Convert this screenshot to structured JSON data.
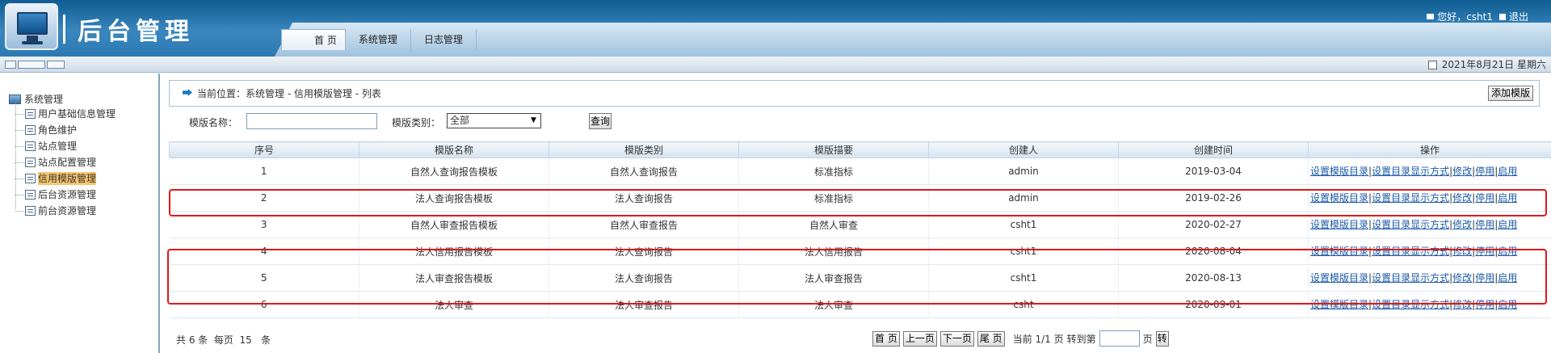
{
  "header": {
    "title": "后台管理",
    "greeting": "您好，csht1",
    "logout": "退出",
    "nav": [
      "首 页",
      "系统管理",
      "日志管理"
    ]
  },
  "subbar": {
    "date": "2021年8月21日 星期六"
  },
  "sidebar": {
    "root": "系统管理",
    "items": [
      "用户基础信息管理",
      "角色维护",
      "站点管理",
      "站点配置管理",
      "信用模版管理",
      "后台资源管理",
      "前台资源管理"
    ],
    "active_index": 4
  },
  "breadcrumb": {
    "label": "当前位置：",
    "path": "系统管理 - 信用模版管理 - 列表"
  },
  "toolbar": {
    "add_label": "添加模版"
  },
  "search": {
    "name_label": "模版名称：",
    "name_value": "",
    "type_label": "模版类别：",
    "type_value": "全部",
    "query_label": "查询"
  },
  "table": {
    "headers": [
      "序号",
      "模版名称",
      "模版类别",
      "模版描要",
      "创建人",
      "创建时间",
      "操作"
    ],
    "rows": [
      [
        "1",
        "自然人查询报告模板",
        "自然人查询报告",
        "标准指标",
        "admin",
        "2019-03-04"
      ],
      [
        "2",
        "法人查询报告模板",
        "法人查询报告",
        "标准指标",
        "admin",
        "2019-02-26"
      ],
      [
        "3",
        "自然人审查报告模板",
        "自然人审查报告",
        "自然人审查",
        "csht1",
        "2020-02-27"
      ],
      [
        "4",
        "法人信用报告模板",
        "法人查询报告",
        "法人信用报告",
        "csht1",
        "2020-08-04"
      ],
      [
        "5",
        "法人审查报告模板",
        "法人查询报告",
        "法人审查报告",
        "csht1",
        "2020-08-13"
      ],
      [
        "6",
        "法人审查",
        "法人审查报告",
        "法人审查",
        "csht",
        "2020-09-01"
      ]
    ],
    "ops": [
      "设置模版目录",
      "设置目录显示方式",
      "修改",
      "停用",
      "启用"
    ]
  },
  "pager": {
    "summary": "共 6 条  每页  15   条",
    "first": "首 页",
    "prev": "上一页",
    "next": "下一页",
    "last": "尾 页",
    "current": "当前 1/1 页",
    "jump_label": "转到第",
    "page_unit": "页",
    "go": "转"
  },
  "colors": {
    "header_blue": "#2d79b3",
    "highlight": "#e01818",
    "link": "#1a5aa8",
    "active_item": "#f7c66e"
  },
  "icons": [
    "monitor-logo-icon",
    "mail-icon",
    "exit-icon",
    "calendar-icon",
    "arrow-right-icon",
    "page-icon",
    "tree-root-icon"
  ]
}
